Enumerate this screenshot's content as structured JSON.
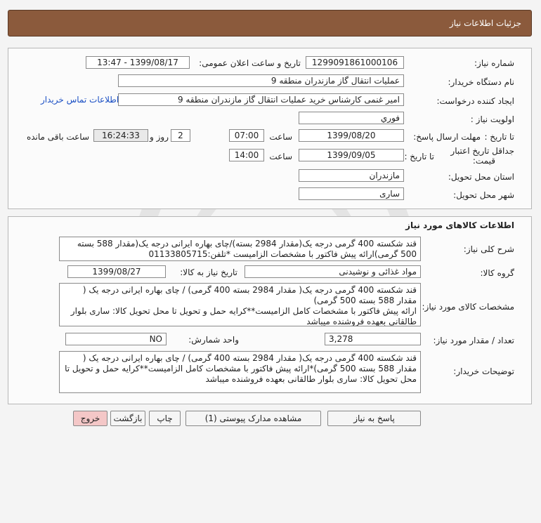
{
  "header": {
    "title": "جزئیات اطلاعات نیاز"
  },
  "fields": {
    "need_number_label": "شماره نیاز:",
    "need_number": "1299091861000106",
    "announce_label": "تاریخ و ساعت اعلان عمومی:",
    "announce_value": "1399/08/17 - 13:47",
    "buyer_label": "نام دستگاه خریدار:",
    "buyer_value": "عملیات انتقال گاز مازندران منطقه 9",
    "creator_label": "ایجاد کننده درخواست:",
    "creator_value": "امیر غنمی کارشناس خرید عملیات انتقال گاز مازندران منطقه 9",
    "contact_link": "اطلاعات تماس خریدار",
    "priority_label": "اولویت نیاز :",
    "priority_value": "فوري",
    "deadline_label": "مهلت ارسال پاسخ:",
    "until_date_label": "تا تاریخ :",
    "deadline_date": "1399/08/20",
    "time_label": "ساعت",
    "deadline_time": "07:00",
    "days_value": "2",
    "days_label": "روز و",
    "remaining_time": "16:24:33",
    "remaining_label": "ساعت باقی مانده",
    "validity_label_1": "جداقل تاریخ اعتبار",
    "validity_label_2": "قیمت:",
    "validity_until_label": "تا تاریخ :",
    "validity_date": "1399/09/05",
    "validity_time_label": "ساعت",
    "validity_time": "14:00",
    "province_label": "استان محل تحویل:",
    "province_value": "مازندران",
    "city_label": "شهر محل تحویل:",
    "city_value": "ساری"
  },
  "goods": {
    "section_title": "اطلاعات کالاهای مورد نیاز",
    "summary_label": "شرح کلی نیاز:",
    "summary_line1": "قند شکسته 400 گرمی درجه یک(مقدار 2984 بسته)/چای بهاره ایرانی درجه یک(مقدار 588 بسته",
    "summary_line2": "500 گرمی)ارائه پیش فاکتور با مشخصات  الزامیست *تلفن:01133805715",
    "group_label": "گروه کالا:",
    "group_value": "مواد غذائی و نوشیدنی",
    "need_date_label": "تاریخ نیاز به کالا:",
    "need_date": "1399/08/27",
    "specs_label": "مشخصات کالای مورد نیاز:",
    "specs_line1": "قند شکسته 400 گرمی درجه یک( مقدار 2984 بسته 400 گرمی) / چای بهاره ایرانی درجه یک (",
    "specs_line2": "مقدار 588 بسته 500 گرمی)",
    "specs_line3": "ارائه پیش فاکتور با مشخصات کامل الزامیست**کرایه حمل و تحویل تا محل تحویل کالا: ساری بلوار",
    "specs_line4": "طالقانی بعهده فروشنده میباشد",
    "qty_label": "تعداد / مقدار مورد نیاز:",
    "qty_value": "3,278",
    "unit_label": "واحد شمارش:",
    "unit_value": "NO",
    "buyer_notes_label": "توضیحات خریدار:",
    "notes_line1": "قند شکسته 400 گرمی درجه یک( مقدار 2984 بسته 400 گرمی) / چای بهاره ایرانی درجه یک (",
    "notes_line2": "مقدار 588 بسته 500 گرمی)*ارائه پیش فاکتور با مشخصات کامل الزامیست**کرایه حمل و تحویل تا",
    "notes_line3": "محل تحویل کالا: ساری بلوار طالقانی بعهده فروشنده میباشد"
  },
  "buttons": {
    "reply": "پاسخ به نیاز",
    "attachments": "مشاهده مدارک پیوستی (1)",
    "print": "چاپ",
    "back": "بازگشت",
    "exit": "خروج"
  },
  "colors": {
    "header_bg": "#8b5a3c",
    "exit_bg": "#f4c7c7",
    "link": "#1a4fc4"
  }
}
